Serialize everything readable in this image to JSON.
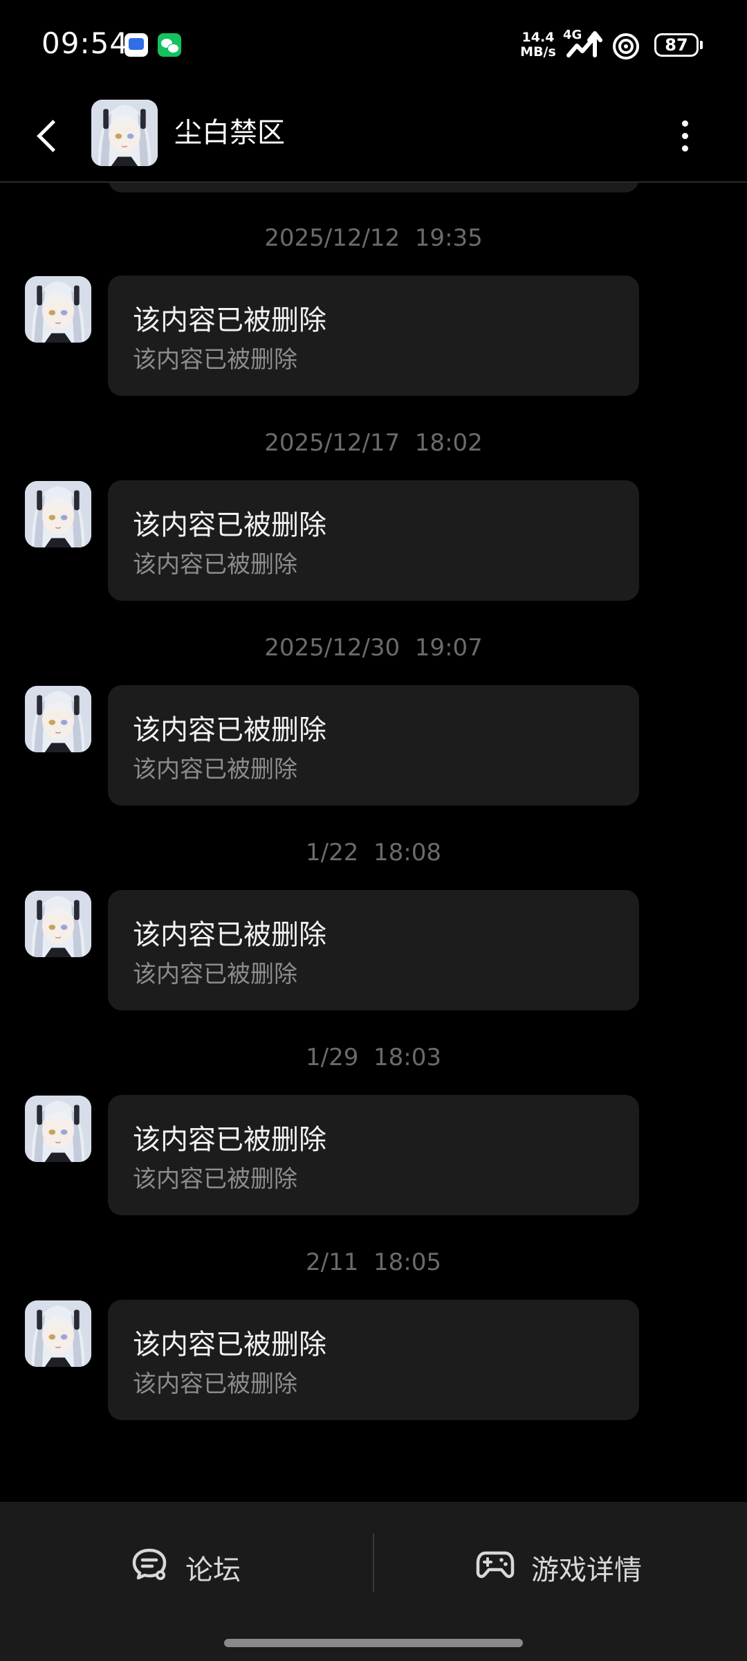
{
  "status_bar": {
    "time": "09:54",
    "net_speed_value": "14.4",
    "net_speed_unit": "MB/s",
    "network_type": "4G",
    "battery_level": "87",
    "icons": [
      "messages-app-icon",
      "wechat-icon",
      "signal-icon",
      "hotspot-icon",
      "battery-icon"
    ]
  },
  "header": {
    "title": "尘白禁区",
    "icons": [
      "back-icon",
      "avatar",
      "more-vertical-icon"
    ]
  },
  "messages": [
    {
      "timestamp": "2025/12/12  19:35",
      "title": "该内容已被删除",
      "text": "该内容已被删除"
    },
    {
      "timestamp": "2025/12/17  18:02",
      "title": "该内容已被删除",
      "text": "该内容已被删除"
    },
    {
      "timestamp": "2025/12/30  19:07",
      "title": "该内容已被删除",
      "text": "该内容已被删除"
    },
    {
      "timestamp": "1/22  18:08",
      "title": "该内容已被删除",
      "text": "该内容已被删除"
    },
    {
      "timestamp": "1/29  18:03",
      "title": "该内容已被删除",
      "text": "该内容已被删除"
    },
    {
      "timestamp": "2/11  18:05",
      "title": "该内容已被删除",
      "text": "该内容已被删除"
    }
  ],
  "bottom_bar": {
    "forum_label": "论坛",
    "game_details_label": "游戏详情",
    "icons": [
      "forum-icon",
      "gamepad-icon"
    ]
  },
  "colors": {
    "background": "#000000",
    "bubble": "#1c1c1c",
    "timestamp": "#6b6b6b",
    "bottom_bar": "#1b1b1b"
  }
}
